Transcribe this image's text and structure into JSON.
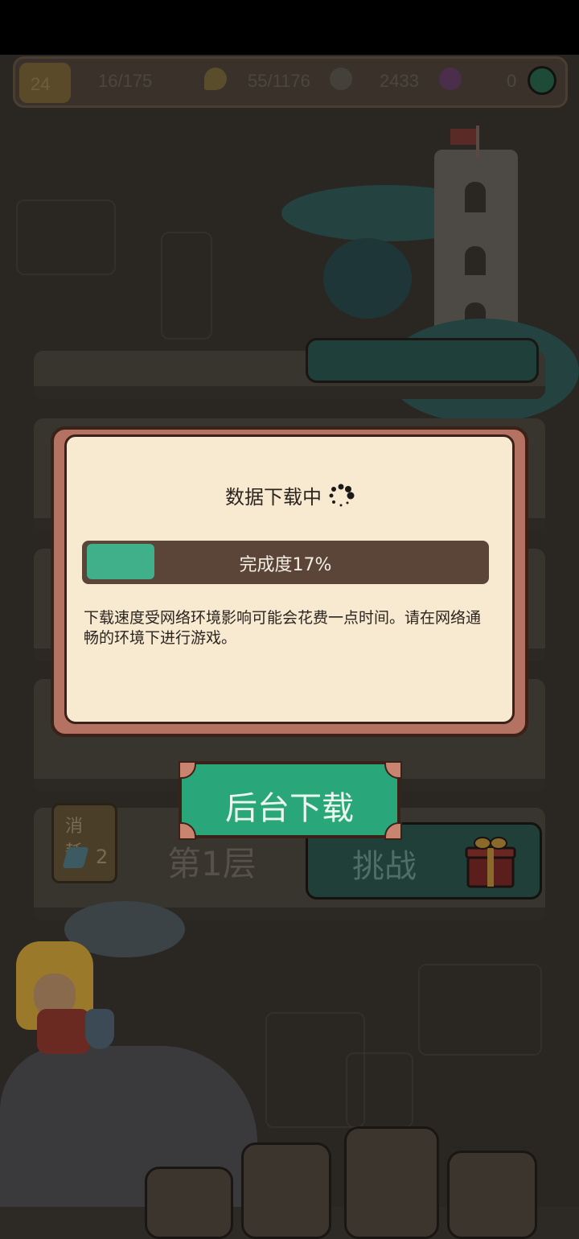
{
  "resource_bar": {
    "level": "24",
    "stamina": "16/175",
    "food": "55/1176",
    "coins": "2433",
    "gems": "0",
    "add_icon": "plus-circle-icon"
  },
  "floors": {
    "floor1_cost_title": "消 耗",
    "floor1_cost_value": "2",
    "floor1_label": "第1层",
    "floor1_button": "挑战"
  },
  "dialog": {
    "title": "数据下载中",
    "progress_label": "完成度17%",
    "progress_value": 0.17,
    "description": "下载速度受网络环境影响可能会花费一点时间。请在网络通畅的环境下进行游戏。",
    "accent_color": "#3fb08a"
  },
  "background_download_button": "后台下载",
  "colors": {
    "dialog_bg": "#f7ead1",
    "dialog_border": "#b47362",
    "button_green": "#2aa77a"
  }
}
